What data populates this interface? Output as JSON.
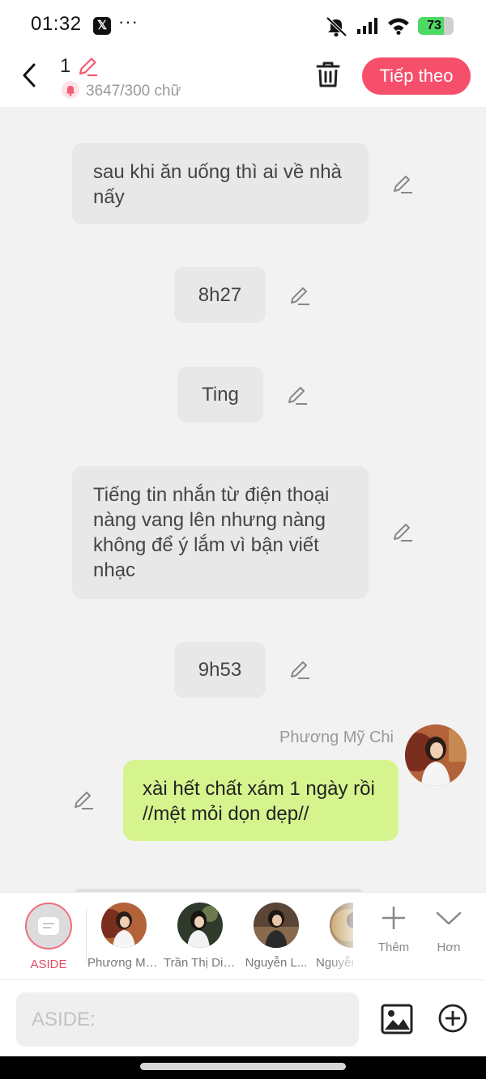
{
  "status_bar": {
    "time": "01:32",
    "x_label": "𝕏",
    "more": "···",
    "battery": "73",
    "battery_level": 0.73
  },
  "header": {
    "chapter_number": "1",
    "word_count": "3647/300 chữ",
    "next_label": "Tiếp theo"
  },
  "messages": [
    {
      "type": "narration",
      "text": "sau khi ăn uống thì ai về nhà nấy"
    },
    {
      "type": "narration",
      "text": "8h27"
    },
    {
      "type": "narration",
      "text": "Ting"
    },
    {
      "type": "narration",
      "text": "Tiếng tin nhắn từ điện thoại nàng vang lên nhưng nàng không để ý lắm vì bận viết nhạc"
    },
    {
      "type": "narration",
      "text": "9h53"
    },
    {
      "type": "character",
      "speaker": "Phương Mỹ Chi",
      "text": "xài hết chất xám 1 ngày rồi //mệt mỏi dọn dẹp//"
    }
  ],
  "character_bar": {
    "aside_label": "ASIDE",
    "characters": [
      {
        "name": "Phương Mỹ Chi"
      },
      {
        "name": "Trần Thị Diễm"
      },
      {
        "name": "Nguyễn L..."
      },
      {
        "name": "Nguyễn"
      }
    ],
    "add_label": "Thêm",
    "more_label": "Hơn"
  },
  "input": {
    "placeholder": "ASIDE:"
  },
  "colors": {
    "accent": "#f64f6c",
    "character_bubble": "#d5f48e",
    "narration_bubble": "#e8e8e8"
  }
}
